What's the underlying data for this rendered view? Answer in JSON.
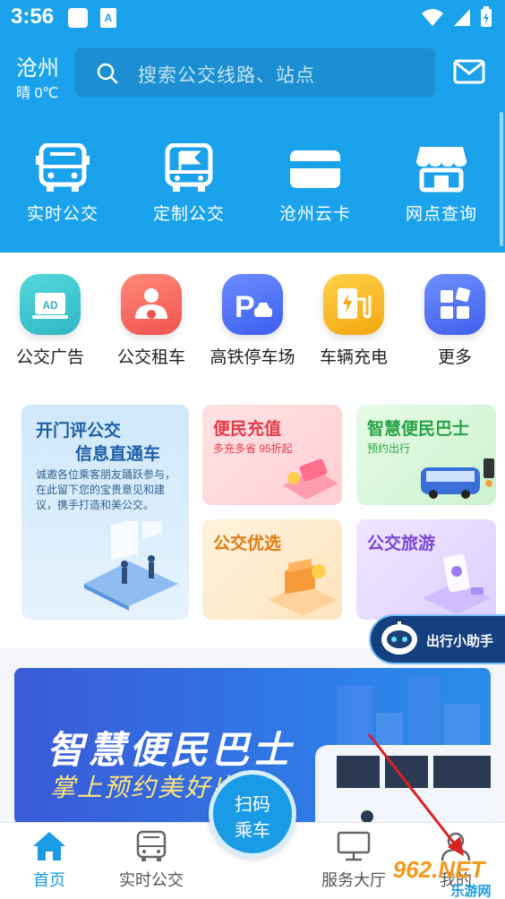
{
  "status_bar": {
    "time": "3:56"
  },
  "header": {
    "city": "沧州",
    "weather": "晴 0℃",
    "search_placeholder": "搜索公交线路、站点"
  },
  "main_nav": [
    {
      "label": "实时公交",
      "icon": "bus-icon"
    },
    {
      "label": "定制公交",
      "icon": "custom-bus-icon"
    },
    {
      "label": "沧州云卡",
      "icon": "card-icon"
    },
    {
      "label": "网点查询",
      "icon": "store-icon"
    }
  ],
  "services": [
    {
      "label": "公交广告",
      "icon": "ad-icon",
      "color": "#3cc4c8"
    },
    {
      "label": "公交租车",
      "icon": "driver-icon",
      "color": "#f25f5c"
    },
    {
      "label": "高铁停车场",
      "icon": "parking-icon",
      "color": "#4e74f5"
    },
    {
      "label": "车辆充电",
      "icon": "charging-icon",
      "color": "#f5b416"
    },
    {
      "label": "更多",
      "icon": "more-icon",
      "color": "#4f73f0"
    }
  ],
  "feedback_card": {
    "title": "开门评公交",
    "subtitle": "信息直通车",
    "body": "诚邀各位乘客朋友踊跃参与，在此留下您的宝贵意见和建议，携手打造和美公交。"
  },
  "promo_cards": [
    {
      "title": "便民充值",
      "subtitle": "多充多省 95折起"
    },
    {
      "title": "智慧便民巴士",
      "subtitle": "预约出行"
    },
    {
      "title": "公交优选",
      "subtitle": ""
    },
    {
      "title": "公交旅游",
      "subtitle": ""
    }
  ],
  "assistant": {
    "label": "出行小助手"
  },
  "banner": {
    "title": "智慧便民巴士",
    "slogan": "掌上预约美好出行"
  },
  "tabs": [
    {
      "label": "首页",
      "active": true
    },
    {
      "label": "实时公交",
      "active": false
    },
    {
      "label": "服务大厅",
      "active": false
    },
    {
      "label": "我的",
      "active": false
    }
  ],
  "scan_button": {
    "line1": "扫码",
    "line2": "乘车"
  },
  "watermark": {
    "text": "962.NET",
    "sub": "乐游网"
  },
  "colors": {
    "primary": "#1aa3ec",
    "tab_active": "#1a9be6"
  }
}
